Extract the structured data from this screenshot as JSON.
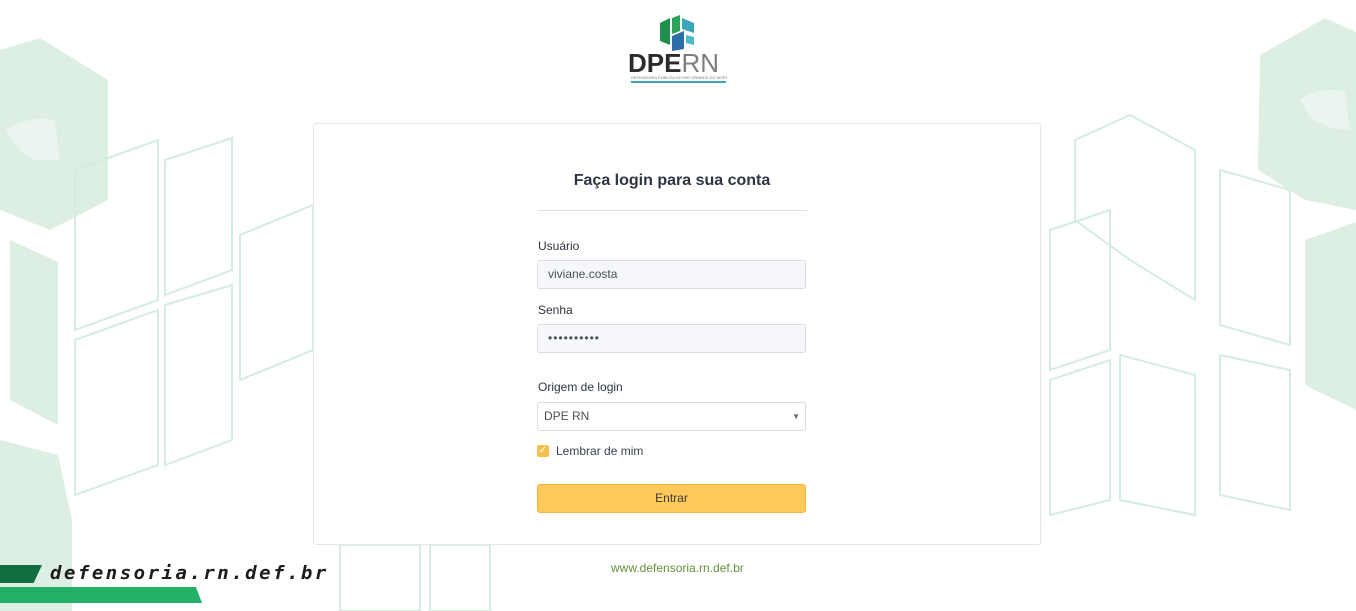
{
  "logo": {
    "text_main": "DPE",
    "text_accent": "RN",
    "subtitle": "DEFENSORIA PÚBLICA DO RIO GRANDE DO NORTE",
    "colors": [
      "#1f8f4d",
      "#3aa7b8",
      "#2d6ea8"
    ]
  },
  "login": {
    "title": "Faça login para sua conta",
    "username_label": "Usuário",
    "username_value": "viviane.costa",
    "password_label": "Senha",
    "password_value": "••••••••••",
    "origin_label": "Origem de login",
    "origin_value": "DPE RN",
    "remember_label": "Lembrar de mim",
    "remember_checked": true,
    "submit_label": "Entrar"
  },
  "footer": {
    "site_link": "www.defensoria.rn.def.br",
    "ribbon_text": "defensoria.rn.def.br"
  },
  "colors": {
    "accent": "#ffc95a",
    "bg_pattern": "#dff0e4",
    "link": "#6a8f3a",
    "ribbon_dark": "#0f6d3f",
    "ribbon_green": "#22b067"
  }
}
